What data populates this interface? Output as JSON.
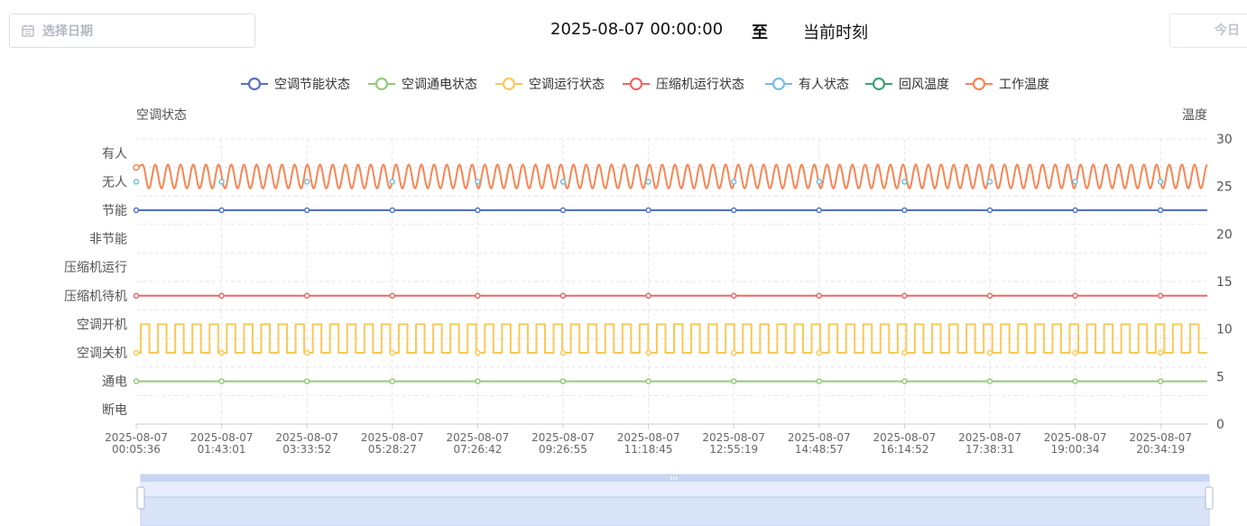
{
  "header": {
    "date_placeholder": "选择日期",
    "range_start": "2025-08-07 00:00:00",
    "range_sep": "至",
    "range_end": "当前时刻",
    "today_label": "今日"
  },
  "icons": {
    "date": "calendar-icon"
  },
  "colors": {
    "energy": "#5470c6",
    "power": "#91cc75",
    "run": "#fac858",
    "compressor": "#ee6666",
    "occupancy": "#73c0de",
    "return_temp": "#3ba272",
    "work_temp": "#fc8452",
    "grid": "#e6e6e6",
    "axis": "#999999"
  },
  "chart_data": {
    "type": "line",
    "left_axis_name": "空调状态",
    "right_axis_name": "温度",
    "left_categories": [
      "断电",
      "通电",
      "空调关机",
      "空调开机",
      "压缩机待机",
      "压缩机运行",
      "非节能",
      "节能",
      "无人",
      "有人"
    ],
    "right_ylim": [
      0,
      30
    ],
    "right_ticks": [
      "0",
      "5",
      "10",
      "15",
      "20",
      "25",
      "30"
    ],
    "x_ticks": [
      [
        "2025-08-07",
        "00:05:36"
      ],
      [
        "2025-08-07",
        "01:43:01"
      ],
      [
        "2025-08-07",
        "03:33:52"
      ],
      [
        "2025-08-07",
        "05:28:27"
      ],
      [
        "2025-08-07",
        "07:26:42"
      ],
      [
        "2025-08-07",
        "09:26:55"
      ],
      [
        "2025-08-07",
        "11:18:45"
      ],
      [
        "2025-08-07",
        "12:55:19"
      ],
      [
        "2025-08-07",
        "14:48:57"
      ],
      [
        "2025-08-07",
        "16:14:52"
      ],
      [
        "2025-08-07",
        "17:38:31"
      ],
      [
        "2025-08-07",
        "19:00:34"
      ],
      [
        "2025-08-07",
        "20:34:19"
      ]
    ],
    "legend": [
      "空调节能状态",
      "空调通电状态",
      "空调运行状态",
      "压缩机运行状态",
      "有人状态",
      "回风温度",
      "工作温度"
    ],
    "series": [
      {
        "name": "空调节能状态",
        "value": "节能"
      },
      {
        "name": "空调通电状态",
        "value": "通电"
      },
      {
        "name": "空调运行状态",
        "value": "空调关机",
        "alternate": "空调开机",
        "cycles": 62
      },
      {
        "name": "压缩机运行状态",
        "value": "压缩机待机"
      },
      {
        "name": "有人状态",
        "value": "无人"
      },
      {
        "name": "回风温度",
        "value": null
      },
      {
        "name": "工作温度",
        "temp_low": 24.8,
        "temp_high": 27.3,
        "cycles": 84
      }
    ]
  }
}
